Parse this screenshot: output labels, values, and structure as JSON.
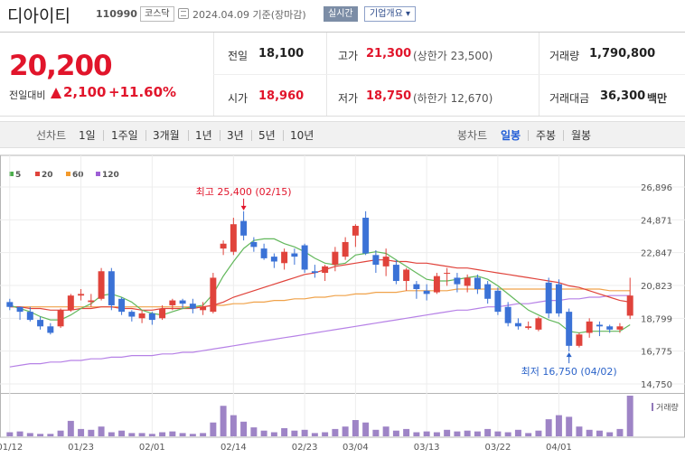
{
  "header": {
    "company": "디아이티",
    "code": "110990",
    "market": "코스닥",
    "date": "2024.04.09 기준(장마감)",
    "realtime_label": "실시간",
    "overview_label": "기업개요 ▾"
  },
  "summary": {
    "price": "20,200",
    "change_label": "전일대비",
    "change": "2,100",
    "change_pct": "+11.60%",
    "prev_close_label": "전일",
    "prev_close": "18,100",
    "open_label": "시가",
    "open": "18,960",
    "high_label": "고가",
    "high": "21,300",
    "upper_limit": "(상한가 23,500)",
    "low_label": "저가",
    "low": "18,750",
    "lower_limit": "(하한가 12,670)",
    "volume_label": "거래량",
    "volume": "1,790,800",
    "amount_label": "거래대금",
    "amount": "36,300",
    "amount_unit": "백만",
    "up_color": "#e1152b"
  },
  "periods": {
    "line_label": "선차트",
    "line_items": [
      "1일",
      "1주일",
      "3개월",
      "1년",
      "3년",
      "5년",
      "10년"
    ],
    "candle_label": "봉차트",
    "candle_items": [
      "일봉",
      "주봉",
      "월봉"
    ],
    "selected": "일봉"
  },
  "chart_data": {
    "type": "candlestick",
    "legend": [
      {
        "name": "5",
        "color": "#4cae4c"
      },
      {
        "name": "20",
        "color": "#e0433b"
      },
      {
        "name": "60",
        "color": "#f39a2b"
      },
      {
        "name": "120",
        "color": "#9e5fd6"
      }
    ],
    "y_ticks": [
      "26,896",
      "24,871",
      "22,847",
      "20,823",
      "18,799",
      "16,775",
      "14,750"
    ],
    "y_range": [
      14750,
      26896
    ],
    "x_tick_labels": [
      "01/12",
      "01/23",
      "02/01",
      "02/14",
      "02/23",
      "03/04",
      "03/13",
      "03/22",
      "04/01"
    ],
    "x_tick_index": [
      0,
      7,
      14,
      22,
      29,
      34,
      41,
      48,
      54
    ],
    "annotation_high": "최고 25,400 (02/15)",
    "annotation_low": "최저 16,750 (04/02)",
    "volume_label": "거래량",
    "up_color": "#e0433b",
    "down_color": "#3b72d6",
    "candles": [
      [
        19800,
        20000,
        19300,
        19500
      ],
      [
        19500,
        19500,
        18700,
        19200
      ],
      [
        19200,
        19500,
        18600,
        18700
      ],
      [
        18700,
        18900,
        18100,
        18300
      ],
      [
        18300,
        18500,
        17800,
        17900
      ],
      [
        18300,
        19400,
        18200,
        19300
      ],
      [
        19300,
        20300,
        19200,
        20200
      ],
      [
        20200,
        20600,
        19900,
        20300
      ],
      [
        19800,
        20300,
        19500,
        19900
      ],
      [
        20000,
        21900,
        19900,
        21700
      ],
      [
        21700,
        21900,
        19300,
        19600
      ],
      [
        20000,
        20100,
        19000,
        19200
      ],
      [
        19200,
        19300,
        18600,
        18900
      ],
      [
        18800,
        19300,
        18500,
        19100
      ],
      [
        19100,
        19200,
        18400,
        18700
      ],
      [
        18800,
        19600,
        18700,
        19400
      ],
      [
        19600,
        20000,
        19300,
        19900
      ],
      [
        19900,
        20000,
        19400,
        19700
      ],
      [
        19700,
        20000,
        19100,
        19400
      ],
      [
        19300,
        19800,
        19000,
        19500
      ],
      [
        19200,
        21600,
        19100,
        21300
      ],
      [
        23100,
        23600,
        22700,
        23400
      ],
      [
        22900,
        25000,
        22700,
        24600
      ],
      [
        24800,
        25400,
        23600,
        23900
      ],
      [
        23500,
        23800,
        22900,
        23200
      ],
      [
        23100,
        23400,
        22400,
        22500
      ],
      [
        22600,
        22800,
        21900,
        22300
      ],
      [
        22200,
        23100,
        21800,
        22900
      ],
      [
        22800,
        23100,
        22100,
        22600
      ],
      [
        23300,
        23400,
        21600,
        21800
      ],
      [
        21700,
        22100,
        21300,
        21600
      ],
      [
        21600,
        22100,
        21100,
        22000
      ],
      [
        22100,
        23200,
        21700,
        22900
      ],
      [
        22600,
        23800,
        22400,
        23500
      ],
      [
        23900,
        24600,
        23200,
        24500
      ],
      [
        25000,
        25400,
        22700,
        22800
      ],
      [
        22700,
        23000,
        21600,
        22100
      ],
      [
        22000,
        23100,
        21400,
        22600
      ],
      [
        22100,
        22400,
        20900,
        21100
      ],
      [
        21100,
        21900,
        20500,
        21800
      ],
      [
        20900,
        21100,
        20000,
        20600
      ],
      [
        20500,
        20900,
        19900,
        20300
      ],
      [
        20400,
        21600,
        20300,
        21400
      ],
      [
        21600,
        21900,
        20800,
        21600
      ],
      [
        21300,
        21600,
        20400,
        20900
      ],
      [
        20800,
        21500,
        20400,
        21300
      ],
      [
        21300,
        21500,
        20300,
        20600
      ],
      [
        20900,
        21100,
        19700,
        20000
      ],
      [
        20500,
        20700,
        19000,
        19200
      ],
      [
        19500,
        19800,
        18300,
        18500
      ],
      [
        18500,
        18800,
        18100,
        18300
      ],
      [
        18200,
        18600,
        18100,
        18300
      ],
      [
        18100,
        18900,
        18000,
        18800
      ],
      [
        21000,
        21300,
        18800,
        19100
      ],
      [
        20900,
        21200,
        18900,
        19100
      ],
      [
        19200,
        19400,
        16750,
        17100
      ],
      [
        17100,
        17900,
        17000,
        17800
      ],
      [
        17900,
        18800,
        17600,
        18600
      ],
      [
        18400,
        18600,
        17700,
        18300
      ],
      [
        18300,
        18400,
        17900,
        18100
      ],
      [
        18100,
        18500,
        17900,
        18300
      ],
      [
        18960,
        21300,
        18750,
        20200
      ]
    ],
    "volume": [
      10,
      12,
      8,
      6,
      6,
      14,
      38,
      18,
      16,
      24,
      10,
      14,
      8,
      8,
      6,
      10,
      12,
      8,
      6,
      8,
      34,
      75,
      52,
      36,
      22,
      14,
      10,
      20,
      14,
      16,
      8,
      10,
      18,
      24,
      40,
      34,
      16,
      24,
      14,
      18,
      10,
      12,
      10,
      16,
      12,
      14,
      12,
      18,
      12,
      10,
      16,
      8,
      14,
      42,
      52,
      48,
      24,
      16,
      14,
      10,
      18,
      100
    ],
    "ma5": [
      19600,
      19400,
      19200,
      18900,
      18700,
      18700,
      19000,
      19400,
      19700,
      20200,
      20300,
      20100,
      19800,
      19300,
      19100,
      19000,
      19200,
      19400,
      19500,
      19600,
      20300,
      21400,
      22300,
      23100,
      23600,
      23700,
      23700,
      23400,
      23200,
      22900,
      22500,
      22200,
      22100,
      22200,
      22700,
      22800,
      22900,
      22800,
      22400,
      22000,
      21600,
      21200,
      21100,
      21100,
      21200,
      21300,
      21400,
      21200,
      20800,
      20300,
      19800,
      19300,
      19000,
      18700,
      18500,
      18000,
      17900,
      18000,
      18000,
      18000,
      18000,
      18400
    ],
    "ma20": [
      19500,
      19500,
      19400,
      19400,
      19300,
      19300,
      19300,
      19400,
      19400,
      19500,
      19500,
      19400,
      19400,
      19300,
      19300,
      19400,
      19400,
      19400,
      19400,
      19500,
      19600,
      19800,
      20100,
      20300,
      20500,
      20700,
      20900,
      21100,
      21300,
      21500,
      21600,
      21800,
      22000,
      22100,
      22200,
      22300,
      22400,
      22400,
      22300,
      22300,
      22200,
      22200,
      22100,
      22000,
      21900,
      21900,
      21800,
      21700,
      21600,
      21500,
      21400,
      21300,
      21200,
      21100,
      21000,
      20800,
      20700,
      20500,
      20300,
      20100,
      19900,
      19800
    ],
    "ma60": [
      19500,
      19500,
      19500,
      19500,
      19500,
      19500,
      19500,
      19500,
      19500,
      19500,
      19500,
      19500,
      19500,
      19500,
      19500,
      19500,
      19500,
      19500,
      19500,
      19500,
      19600,
      19600,
      19700,
      19700,
      19800,
      19800,
      19900,
      19900,
      20000,
      20000,
      20100,
      20100,
      20200,
      20200,
      20300,
      20300,
      20400,
      20400,
      20400,
      20500,
      20500,
      20500,
      20500,
      20500,
      20600,
      20600,
      20600,
      20600,
      20600,
      20600,
      20600,
      20600,
      20600,
      20600,
      20600,
      20600,
      20600,
      20600,
      20600,
      20500,
      20500,
      20500
    ],
    "ma120": [
      15800,
      15900,
      16000,
      16000,
      16100,
      16100,
      16200,
      16200,
      16300,
      16300,
      16400,
      16400,
      16500,
      16500,
      16500,
      16600,
      16600,
      16700,
      16700,
      16800,
      16900,
      17000,
      17100,
      17200,
      17300,
      17400,
      17500,
      17600,
      17700,
      17800,
      17900,
      18000,
      18100,
      18200,
      18300,
      18400,
      18500,
      18600,
      18700,
      18800,
      18900,
      19000,
      19100,
      19200,
      19300,
      19300,
      19400,
      19500,
      19500,
      19600,
      19700,
      19700,
      19800,
      19900,
      19900,
      20000,
      20000,
      20100,
      20100,
      20200,
      20200,
      20200
    ]
  }
}
